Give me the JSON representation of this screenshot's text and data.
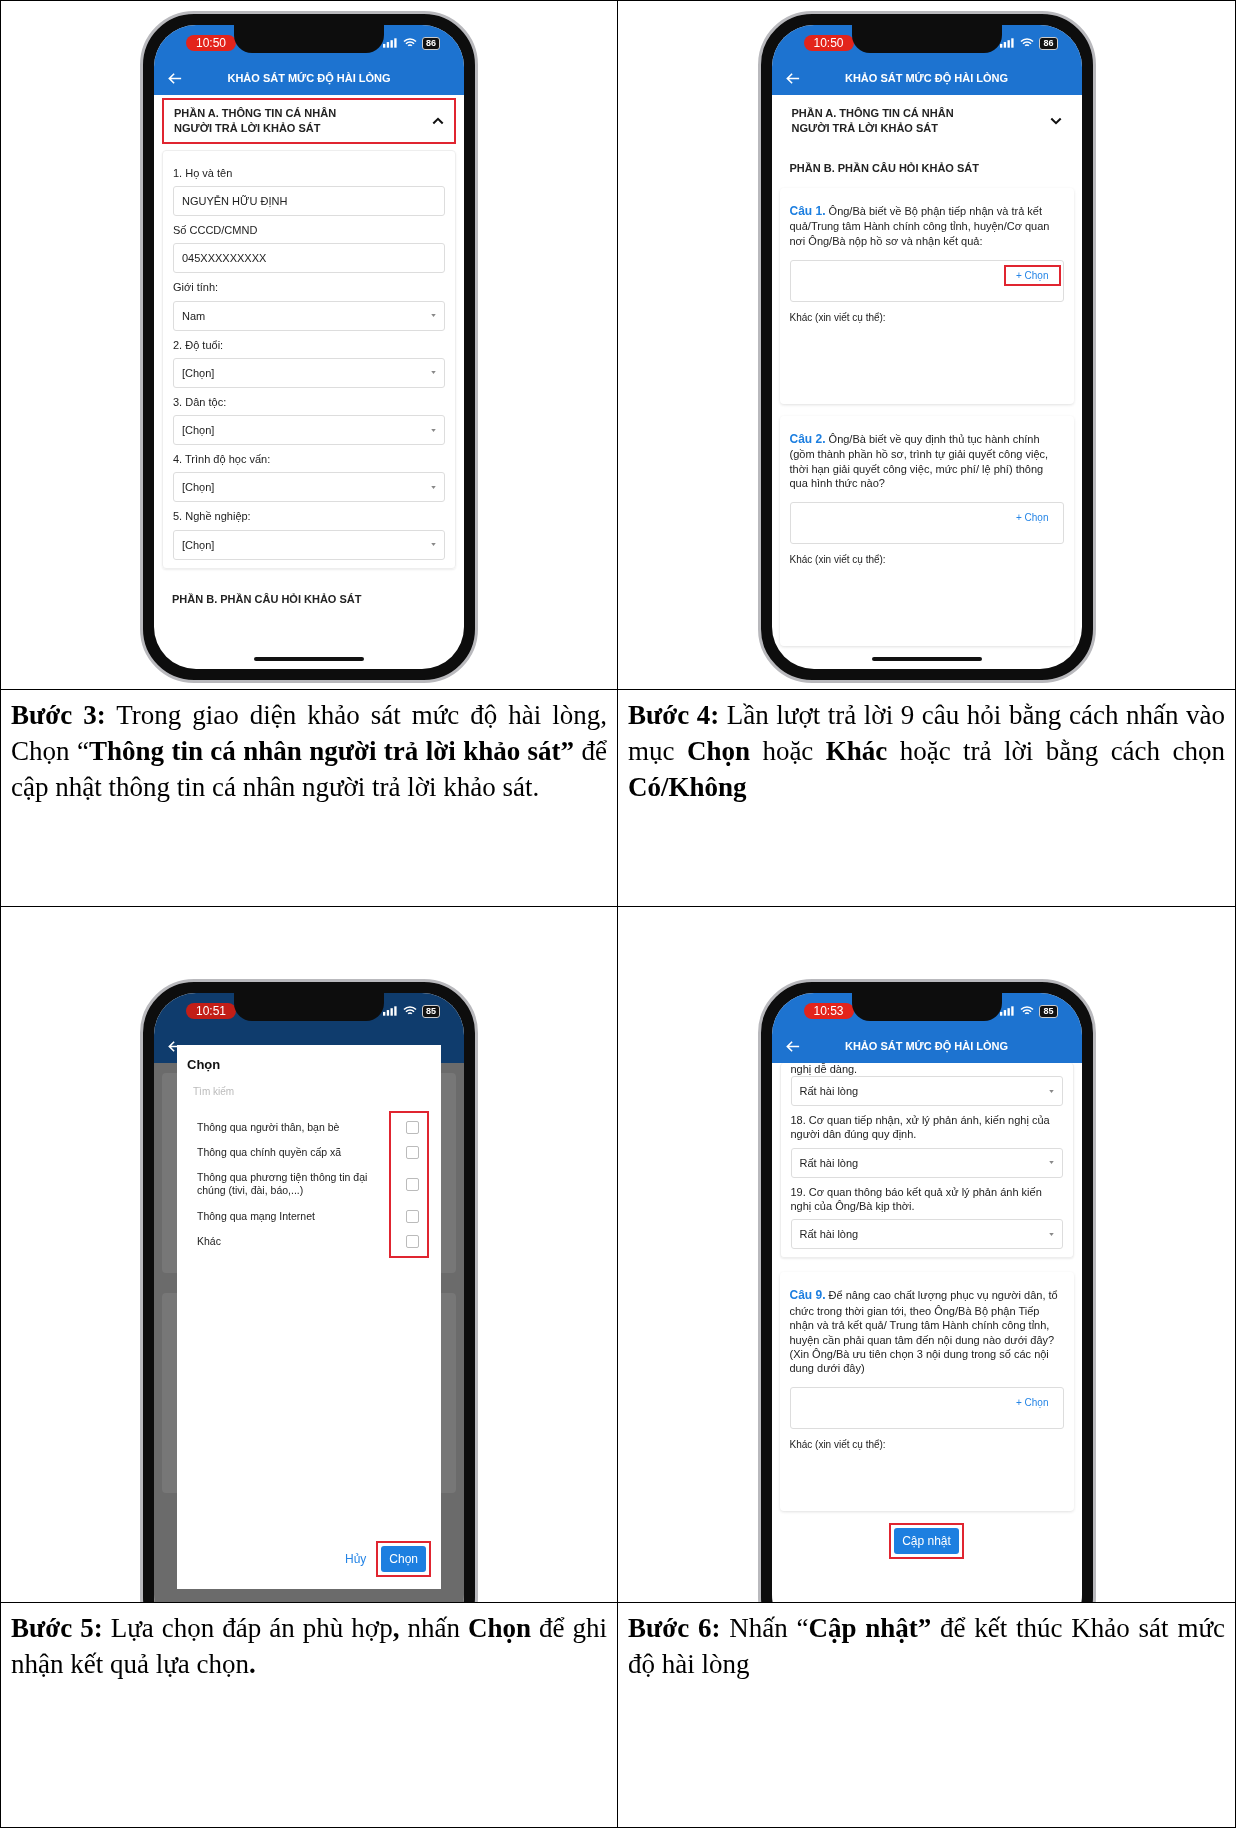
{
  "rows": [
    {
      "screens": [
        {
          "kind": "form",
          "time": "10:50",
          "battery": "86",
          "title": "KHẢO SÁT MỨC ĐỘ HÀI LÒNG",
          "section_a": {
            "title": "PHẦN A. THÔNG TIN CÁ NHÂN NGƯỜI TRẢ LỜI KHẢO SÁT",
            "expanded": true,
            "highlighted": true
          },
          "fields": [
            {
              "label": "1. Họ và tên",
              "value": "NGUYỄN HỮU ĐỊNH",
              "kind": "text"
            },
            {
              "label": "Số CCCD/CMND",
              "value": "045XXXXXXXXX",
              "kind": "text"
            },
            {
              "label": "Giới tính:",
              "value": "Nam",
              "kind": "select"
            },
            {
              "label": "2. Độ tuổi:",
              "value": "[Chọn]",
              "kind": "select"
            },
            {
              "label": "3. Dân tộc:",
              "value": "[Chọn]",
              "kind": "select"
            },
            {
              "label": "4. Trình độ học vấn:",
              "value": "[Chọn]",
              "kind": "select"
            },
            {
              "label": "5. Nghề nghiệp:",
              "value": "[Chọn]",
              "kind": "select"
            }
          ],
          "section_b": "PHẦN B. PHẦN CÂU HỎI KHẢO SÁT"
        },
        {
          "kind": "questions",
          "time": "10:50",
          "battery": "86",
          "title": "KHẢO SÁT MỨC ĐỘ HÀI LÒNG",
          "section_a": {
            "title": "PHẦN A. THÔNG TIN CÁ NHÂN NGƯỜI TRẢ LỜI KHẢO SÁT",
            "expanded": false,
            "highlighted": false
          },
          "section_b": "PHẦN B. PHẦN CÂU HỎI KHẢO SÁT",
          "questions": [
            {
              "number": "Câu 1.",
              "text": "Ông/Bà biết về Bộ phận tiếp nhận và trả kết quả/Trung tâm Hành chính công tỉnh, huyện/Cơ quan nơi Ông/Bà nộp hồ sơ và nhận kết quả:",
              "button": "+ Chọn",
              "highlighted": true,
              "other": "Khác (xin viết cụ thể):"
            },
            {
              "number": "Câu 2.",
              "text": "Ông/Bà biết về quy định thủ tục hành chính (gồm thành phần hồ sơ, trình tự giải quyết công việc, thời hạn giải quyết công việc, mức phí/ lệ phí) thông qua hình thức nào?",
              "button": "+ Chọn",
              "highlighted": false,
              "other": "Khác (xin viết cụ thể):"
            }
          ]
        }
      ],
      "captions": [
        "**Bước 3:** Trong giao diện khảo sát mức độ hài lòng, Chọn “**Thông tin cá nhân người trả lời khảo sát”** để cập nhật thông tin cá nhân người trả lời khảo sát.",
        "**Bước 4:** Lần lượt trả lời 9 câu hỏi bằng cách nhấn vào mục **Chọn** hoặc **Khác** hoặc trả lời bằng cách chọn **Có/Không**"
      ]
    },
    {
      "screens": [
        {
          "kind": "dialog",
          "time": "10:51",
          "battery": "85",
          "dialog": {
            "title": "Chọn",
            "search_placeholder": "Tìm kiếm",
            "options": [
              {
                "label": "Thông qua người thân, bạn bè",
                "checked": false
              },
              {
                "label": "Thông qua chính quyền cấp xã",
                "checked": false
              },
              {
                "label": "Thông qua phương tiện thông tin đại chúng (tivi, đài, báo,...)",
                "checked": false
              },
              {
                "label": "Thông qua mạng Internet",
                "checked": false
              },
              {
                "label": "Khác",
                "checked": false
              }
            ],
            "options_highlighted": true,
            "cancel": "Hủy",
            "confirm": "Chọn",
            "confirm_highlighted": true
          }
        },
        {
          "kind": "scrolled",
          "time": "10:53",
          "battery": "85",
          "title": "KHẢO SÁT MỨC ĐỘ HÀI LÒNG",
          "top_text": "nghị dễ dàng.",
          "ratings": [
            {
              "value": "Rất hài lòng"
            },
            {
              "label": "18. Cơ quan tiếp nhận, xử lý phản ánh, kiến nghị của người dân đúng quy định.",
              "value": "Rất hài lòng"
            },
            {
              "label": "19. Cơ quan thông báo kết quả xử lý phản ánh kiến nghị của Ông/Bà kịp thời.",
              "value": "Rất hài lòng"
            }
          ],
          "question": {
            "number": "Câu 9.",
            "text": "Để nâng cao chất lượng phục vụ người dân, tổ chức trong thời gian tới, theo Ông/Bà Bộ phận Tiếp nhận và trả kết quả/ Trung tâm Hành chính công tỉnh, huyện cần phải quan tâm đến nội dung nào dưới đây? (Xin Ông/Bà ưu tiên chọn 3 nội dung trong số các nội dung dưới đây)",
            "button": "+ Chọn",
            "highlighted": false,
            "other": "Khác (xin viết cụ thể):"
          },
          "update_button": {
            "label": "Cập nhật",
            "highlighted": true
          }
        }
      ],
      "captions": [
        "**Bước 5:** Lựa chọn đáp án phù hợp**,** nhấn **Chọn** để ghi nhận kết quả lựa chọn**.**",
        "**Bước 6:** Nhấn “**Cập nhật”** để kết thúc Khảo sát mức độ hài lòng"
      ]
    }
  ]
}
